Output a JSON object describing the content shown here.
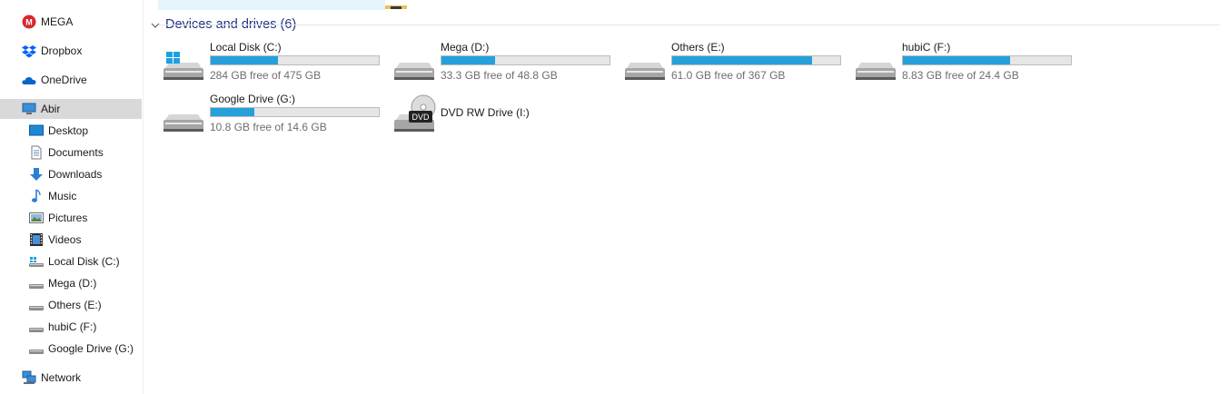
{
  "sidebar": {
    "items": [
      {
        "label": "MEGA",
        "icon": "mega-icon"
      },
      {
        "label": "Dropbox",
        "icon": "dropbox-icon"
      },
      {
        "label": "OneDrive",
        "icon": "onedrive-icon"
      },
      {
        "label": "Abir",
        "icon": "computer-icon",
        "selected": true
      },
      {
        "label": "Desktop",
        "icon": "desktop-icon"
      },
      {
        "label": "Documents",
        "icon": "documents-icon"
      },
      {
        "label": "Downloads",
        "icon": "downloads-icon"
      },
      {
        "label": "Music",
        "icon": "music-icon"
      },
      {
        "label": "Pictures",
        "icon": "pictures-icon"
      },
      {
        "label": "Videos",
        "icon": "videos-icon"
      },
      {
        "label": "Local Disk (C:)",
        "icon": "local-disk-icon"
      },
      {
        "label": "Mega (D:)",
        "icon": "drive-icon"
      },
      {
        "label": "Others (E:)",
        "icon": "drive-icon"
      },
      {
        "label": "hubiC (F:)",
        "icon": "drive-icon"
      },
      {
        "label": "Google Drive (G:)",
        "icon": "drive-icon"
      },
      {
        "label": "Network",
        "icon": "network-icon"
      }
    ]
  },
  "group": {
    "title": "Devices and drives (6)"
  },
  "drives": [
    {
      "name": "Local Disk (C:)",
      "free": "284 GB free of 475 GB",
      "used_fraction": 0.402,
      "icon": "windows-drive-icon"
    },
    {
      "name": "Mega (D:)",
      "free": "33.3 GB free of 48.8 GB",
      "used_fraction": 0.318,
      "icon": "hard-drive-icon"
    },
    {
      "name": "Others (E:)",
      "free": "61.0 GB free of 367 GB",
      "used_fraction": 0.834,
      "icon": "hard-drive-icon"
    },
    {
      "name": "hubiC (F:)",
      "free": "8.83 GB free of 24.4 GB",
      "used_fraction": 0.638,
      "icon": "hard-drive-icon"
    },
    {
      "name": "Google Drive (G:)",
      "free": "10.8 GB free of 14.6 GB",
      "used_fraction": 0.26,
      "icon": "hard-drive-icon"
    },
    {
      "name": "DVD RW Drive (I:)",
      "icon": "dvd-drive-icon"
    }
  ],
  "colors": {
    "bar_fill": "#26a0da",
    "group_title": "#1e3287",
    "selected_bg": "#d9d9d9"
  }
}
